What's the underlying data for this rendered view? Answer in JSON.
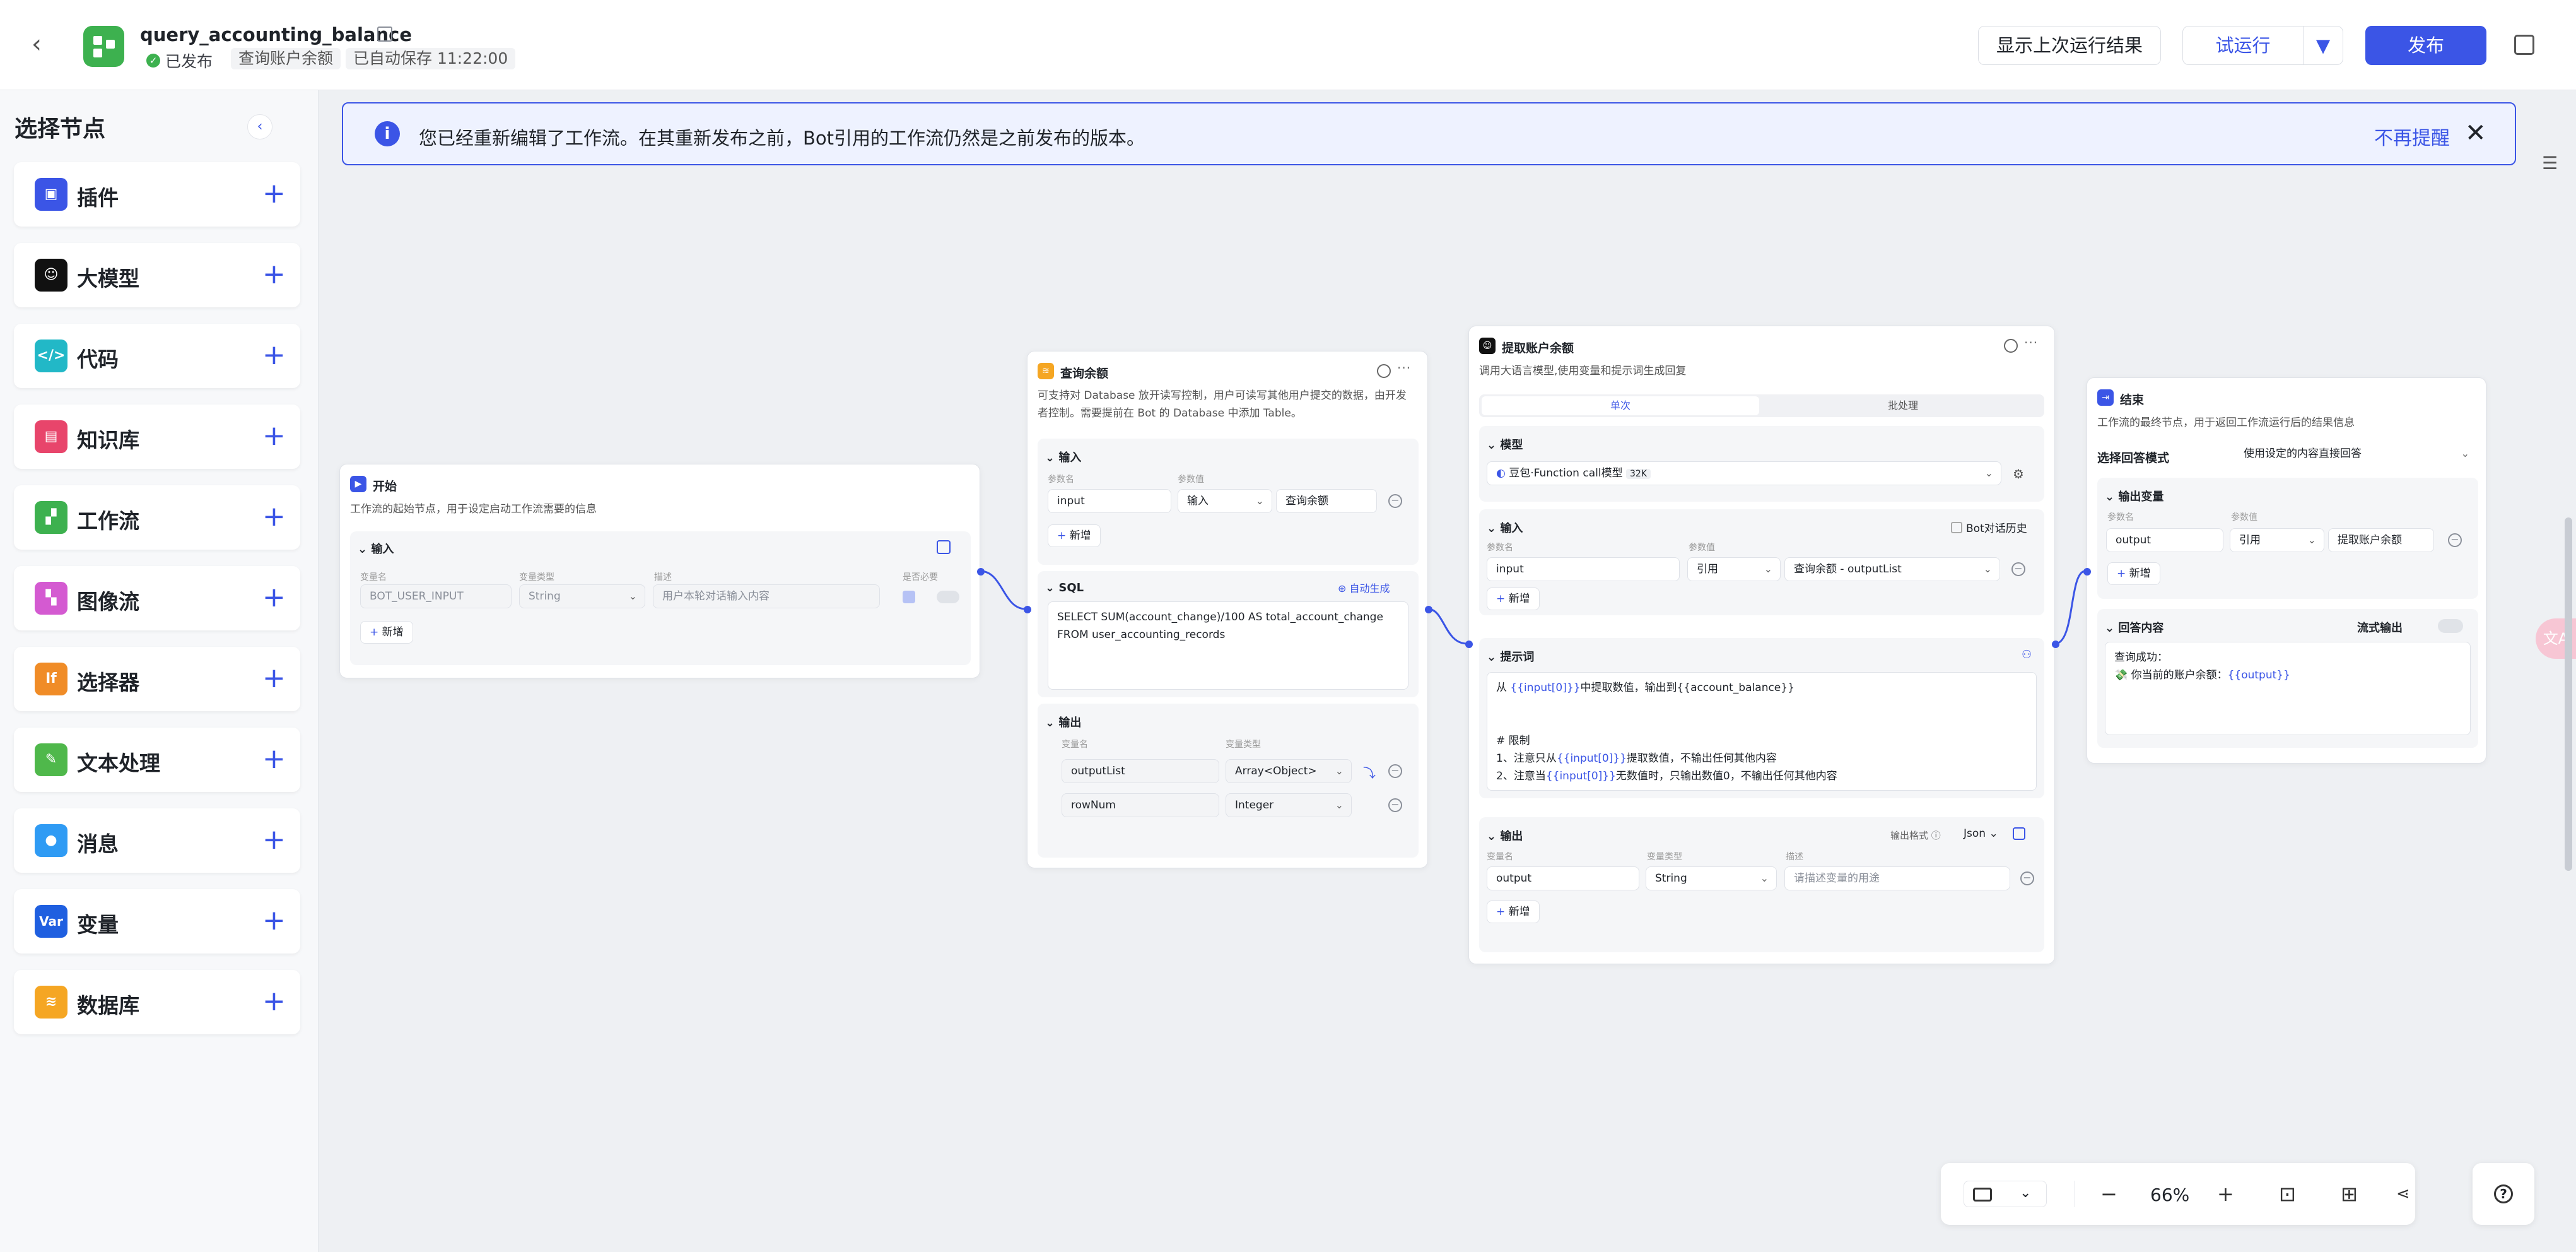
{
  "header": {
    "title": "query_accounting_balance",
    "status": "已发布",
    "tag_name": "查询账户余额",
    "autosave": "已自动保存 11:22:00",
    "show_last_result": "显示上次运行结果",
    "test_run": "试运行",
    "publish": "发布"
  },
  "sidebar": {
    "title": "选择节点",
    "items": [
      {
        "label": "插件",
        "icon": "plugin-icon",
        "color": "#3b55e6"
      },
      {
        "label": "大模型",
        "icon": "llm-icon",
        "color": "#111111"
      },
      {
        "label": "代码",
        "icon": "code-icon",
        "color": "#22b8c7"
      },
      {
        "label": "知识库",
        "icon": "knowledge-icon",
        "color": "#e8456b"
      },
      {
        "label": "工作流",
        "icon": "workflow-icon",
        "color": "#3db14f"
      },
      {
        "label": "图像流",
        "icon": "imageflow-icon",
        "color": "#d45ad1"
      },
      {
        "label": "选择器",
        "icon": "selector-icon",
        "color": "#f08c27",
        "glyph": "If"
      },
      {
        "label": "文本处理",
        "icon": "text-icon",
        "color": "#4fb84b"
      },
      {
        "label": "消息",
        "icon": "message-icon",
        "color": "#2f9bf4"
      },
      {
        "label": "变量",
        "icon": "variable-icon",
        "color": "#1f5fe0",
        "glyph": "Var"
      },
      {
        "label": "数据库",
        "icon": "database-icon",
        "color": "#f5a623"
      }
    ]
  },
  "banner": {
    "text": "您已经重新编辑了工作流。在其重新发布之前，Bot引用的工作流仍然是之前发布的版本。",
    "dismiss": "不再提醒"
  },
  "common": {
    "add": "新增",
    "input": "输入",
    "output": "输出",
    "param_name": "参数名",
    "param_value": "参数值",
    "var_name": "变量名",
    "var_type": "变量类型",
    "description": "描述",
    "required": "是否必要"
  },
  "start_node": {
    "title": "开始",
    "desc": "工作流的起始节点，用于设定启动工作流需要的信息",
    "var_name": "BOT_USER_INPUT",
    "var_type": "String",
    "var_desc_placeholder": "用户本轮对话输入内容"
  },
  "db_node": {
    "title": "查询余额",
    "desc": "可支持对 Database 放开读写控制，用户可读写其他用户提交的数据，由开发者控制。需要提前在 Bot 的 Database 中添加 Table。",
    "input_name": "input",
    "input_mode": "输入",
    "input_value": "查询余额",
    "sql_label": "SQL",
    "auto_gen": "自动生成",
    "sql_line1": "SELECT SUM(account_change)/100 AS total_account_change",
    "sql_line2": "FROM user_accounting_records",
    "outputs": [
      {
        "name": "outputList",
        "type": "Array<Object>"
      },
      {
        "name": "rowNum",
        "type": "Integer"
      }
    ]
  },
  "llm_node": {
    "title": "提取账户余额",
    "desc": "调用大语言模型,使用变量和提示词生成回复",
    "tab_single": "单次",
    "tab_batch": "批处理",
    "model_label": "模型",
    "model_name": "豆包·Function call模型",
    "model_ctx": "32K",
    "bot_history": "Bot对话历史",
    "input_name": "input",
    "input_mode": "引用",
    "input_value": "查询余额 - outputList",
    "prompt_label": "提示词",
    "prompt_l1_pre": "从 ",
    "prompt_l1_var": "{{input[0]}}",
    "prompt_l1_post": "中提取数值，输出到{{account_balance}}",
    "prompt_l2": "# 限制",
    "prompt_l3_pre": "1、注意只从",
    "prompt_l3_var": "{{input[0]}}",
    "prompt_l3_post": "提取数值，不输出任何其他内容",
    "prompt_l4_pre": "2、注意当",
    "prompt_l4_var": "{{input[0]}}",
    "prompt_l4_post": "无数值时，只输出数值0，不输出任何其他内容",
    "output_format_label": "输出格式",
    "output_format": "Json",
    "output_name": "output",
    "output_type": "String",
    "output_desc_placeholder": "请描述变量的用途"
  },
  "end_node": {
    "title": "结束",
    "desc": "工作流的最终节点，用于返回工作流运行后的结果信息",
    "mode_label": "选择回答模式",
    "mode_value": "使用设定的内容直接回答",
    "output_vars": "输出变量",
    "out_name": "output",
    "out_mode": "引用",
    "out_value": "提取账户余额",
    "answer_label": "回答内容",
    "stream_label": "流式输出",
    "answer_l1": "查询成功：",
    "answer_l2_pre": "💸 你当前的账户余额：",
    "answer_l2_var": "{{output}}"
  },
  "zoom": {
    "level": "66%"
  }
}
